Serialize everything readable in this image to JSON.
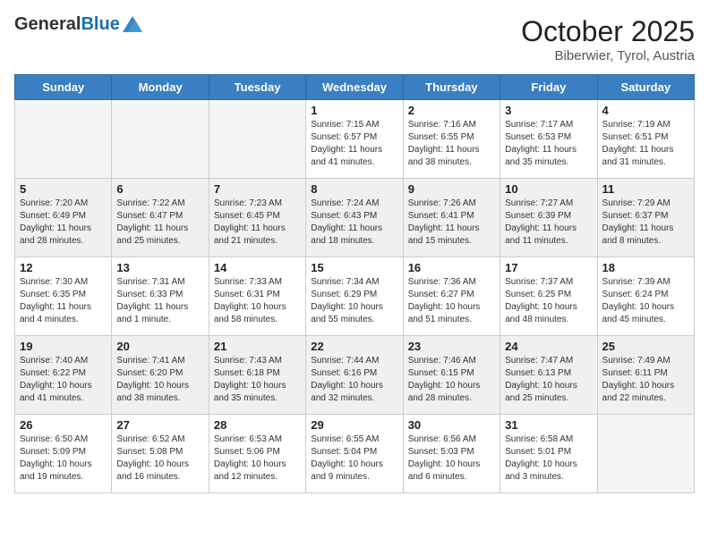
{
  "logo": {
    "general": "General",
    "blue": "Blue"
  },
  "header": {
    "month": "October 2025",
    "location": "Biberwier, Tyrol, Austria"
  },
  "weekdays": [
    "Sunday",
    "Monday",
    "Tuesday",
    "Wednesday",
    "Thursday",
    "Friday",
    "Saturday"
  ],
  "weeks": [
    [
      {
        "day": "",
        "info": ""
      },
      {
        "day": "",
        "info": ""
      },
      {
        "day": "",
        "info": ""
      },
      {
        "day": "1",
        "info": "Sunrise: 7:15 AM\nSunset: 6:57 PM\nDaylight: 11 hours\nand 41 minutes."
      },
      {
        "day": "2",
        "info": "Sunrise: 7:16 AM\nSunset: 6:55 PM\nDaylight: 11 hours\nand 38 minutes."
      },
      {
        "day": "3",
        "info": "Sunrise: 7:17 AM\nSunset: 6:53 PM\nDaylight: 11 hours\nand 35 minutes."
      },
      {
        "day": "4",
        "info": "Sunrise: 7:19 AM\nSunset: 6:51 PM\nDaylight: 11 hours\nand 31 minutes."
      }
    ],
    [
      {
        "day": "5",
        "info": "Sunrise: 7:20 AM\nSunset: 6:49 PM\nDaylight: 11 hours\nand 28 minutes."
      },
      {
        "day": "6",
        "info": "Sunrise: 7:22 AM\nSunset: 6:47 PM\nDaylight: 11 hours\nand 25 minutes."
      },
      {
        "day": "7",
        "info": "Sunrise: 7:23 AM\nSunset: 6:45 PM\nDaylight: 11 hours\nand 21 minutes."
      },
      {
        "day": "8",
        "info": "Sunrise: 7:24 AM\nSunset: 6:43 PM\nDaylight: 11 hours\nand 18 minutes."
      },
      {
        "day": "9",
        "info": "Sunrise: 7:26 AM\nSunset: 6:41 PM\nDaylight: 11 hours\nand 15 minutes."
      },
      {
        "day": "10",
        "info": "Sunrise: 7:27 AM\nSunset: 6:39 PM\nDaylight: 11 hours\nand 11 minutes."
      },
      {
        "day": "11",
        "info": "Sunrise: 7:29 AM\nSunset: 6:37 PM\nDaylight: 11 hours\nand 8 minutes."
      }
    ],
    [
      {
        "day": "12",
        "info": "Sunrise: 7:30 AM\nSunset: 6:35 PM\nDaylight: 11 hours\nand 4 minutes."
      },
      {
        "day": "13",
        "info": "Sunrise: 7:31 AM\nSunset: 6:33 PM\nDaylight: 11 hours\nand 1 minute."
      },
      {
        "day": "14",
        "info": "Sunrise: 7:33 AM\nSunset: 6:31 PM\nDaylight: 10 hours\nand 58 minutes."
      },
      {
        "day": "15",
        "info": "Sunrise: 7:34 AM\nSunset: 6:29 PM\nDaylight: 10 hours\nand 55 minutes."
      },
      {
        "day": "16",
        "info": "Sunrise: 7:36 AM\nSunset: 6:27 PM\nDaylight: 10 hours\nand 51 minutes."
      },
      {
        "day": "17",
        "info": "Sunrise: 7:37 AM\nSunset: 6:25 PM\nDaylight: 10 hours\nand 48 minutes."
      },
      {
        "day": "18",
        "info": "Sunrise: 7:39 AM\nSunset: 6:24 PM\nDaylight: 10 hours\nand 45 minutes."
      }
    ],
    [
      {
        "day": "19",
        "info": "Sunrise: 7:40 AM\nSunset: 6:22 PM\nDaylight: 10 hours\nand 41 minutes."
      },
      {
        "day": "20",
        "info": "Sunrise: 7:41 AM\nSunset: 6:20 PM\nDaylight: 10 hours\nand 38 minutes."
      },
      {
        "day": "21",
        "info": "Sunrise: 7:43 AM\nSunset: 6:18 PM\nDaylight: 10 hours\nand 35 minutes."
      },
      {
        "day": "22",
        "info": "Sunrise: 7:44 AM\nSunset: 6:16 PM\nDaylight: 10 hours\nand 32 minutes."
      },
      {
        "day": "23",
        "info": "Sunrise: 7:46 AM\nSunset: 6:15 PM\nDaylight: 10 hours\nand 28 minutes."
      },
      {
        "day": "24",
        "info": "Sunrise: 7:47 AM\nSunset: 6:13 PM\nDaylight: 10 hours\nand 25 minutes."
      },
      {
        "day": "25",
        "info": "Sunrise: 7:49 AM\nSunset: 6:11 PM\nDaylight: 10 hours\nand 22 minutes."
      }
    ],
    [
      {
        "day": "26",
        "info": "Sunrise: 6:50 AM\nSunset: 5:09 PM\nDaylight: 10 hours\nand 19 minutes."
      },
      {
        "day": "27",
        "info": "Sunrise: 6:52 AM\nSunset: 5:08 PM\nDaylight: 10 hours\nand 16 minutes."
      },
      {
        "day": "28",
        "info": "Sunrise: 6:53 AM\nSunset: 5:06 PM\nDaylight: 10 hours\nand 12 minutes."
      },
      {
        "day": "29",
        "info": "Sunrise: 6:55 AM\nSunset: 5:04 PM\nDaylight: 10 hours\nand 9 minutes."
      },
      {
        "day": "30",
        "info": "Sunrise: 6:56 AM\nSunset: 5:03 PM\nDaylight: 10 hours\nand 6 minutes."
      },
      {
        "day": "31",
        "info": "Sunrise: 6:58 AM\nSunset: 5:01 PM\nDaylight: 10 hours\nand 3 minutes."
      },
      {
        "day": "",
        "info": ""
      }
    ]
  ]
}
